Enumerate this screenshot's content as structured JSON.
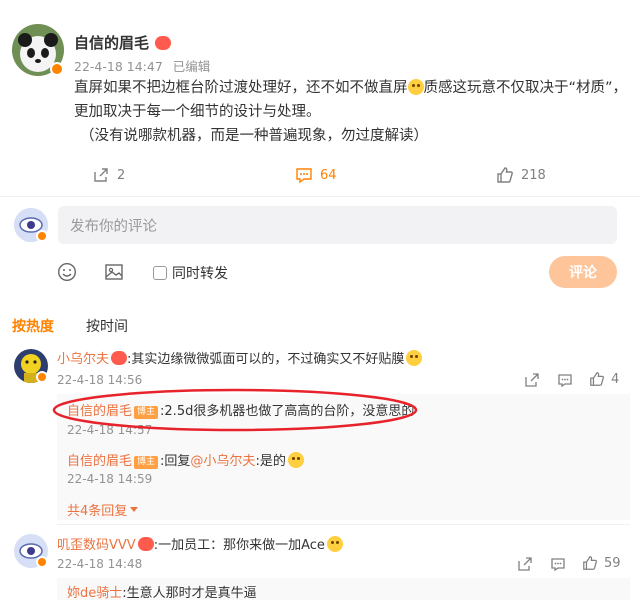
{
  "post": {
    "author": "自信的眉毛",
    "time": "22-4-18 14:47",
    "edited": "已编辑",
    "text_line1a": "直屏如果不把边框台阶过渡处理好，还不如不做直屏",
    "text_line1b": "质感这玩意不仅取决于“材质”，",
    "text_line2": "更加取决于每一个细节的设计与处理。",
    "text_line3": "（没有说哪款机器，而是一种普遍现象，勿过度解读）",
    "forward_count": "2",
    "comment_count": "64",
    "like_count": "218"
  },
  "composer": {
    "placeholder": "发布你的评论",
    "also_forward": "同时转发",
    "submit": "评论"
  },
  "tabs": {
    "hot": "按热度",
    "time": "按时间"
  },
  "comments": [
    {
      "author": "小乌尔夫",
      "text": ":其实边缘微微弧面可以的，不过确实又不好贴膜",
      "time": "22-4-18 14:56",
      "likes": "4",
      "replies": [
        {
          "author": "自信的眉毛",
          "badge": "博主",
          "text": ":2.5d很多机器也做了高高的台阶，没意思的",
          "time": "22-4-18 14:57"
        },
        {
          "author": "自信的眉毛",
          "badge": "博主",
          "text_pre": ":回复",
          "mention": "@小乌尔夫",
          "text_post": ":是的",
          "time": "22-4-18 14:59"
        }
      ],
      "more": "共4条回复"
    },
    {
      "author": "叽歪数码VVV",
      "text": ":一加员工：那你来做一加Ace",
      "time": "22-4-18 14:48",
      "likes": "59",
      "replies": [
        {
          "author": "妳de骑士",
          "text": ":生意人那时才是真牛逼"
        }
      ]
    }
  ],
  "colors": {
    "accent": "#ff8200",
    "name": "#eb7340",
    "highlight_ring": "#e8222a"
  }
}
